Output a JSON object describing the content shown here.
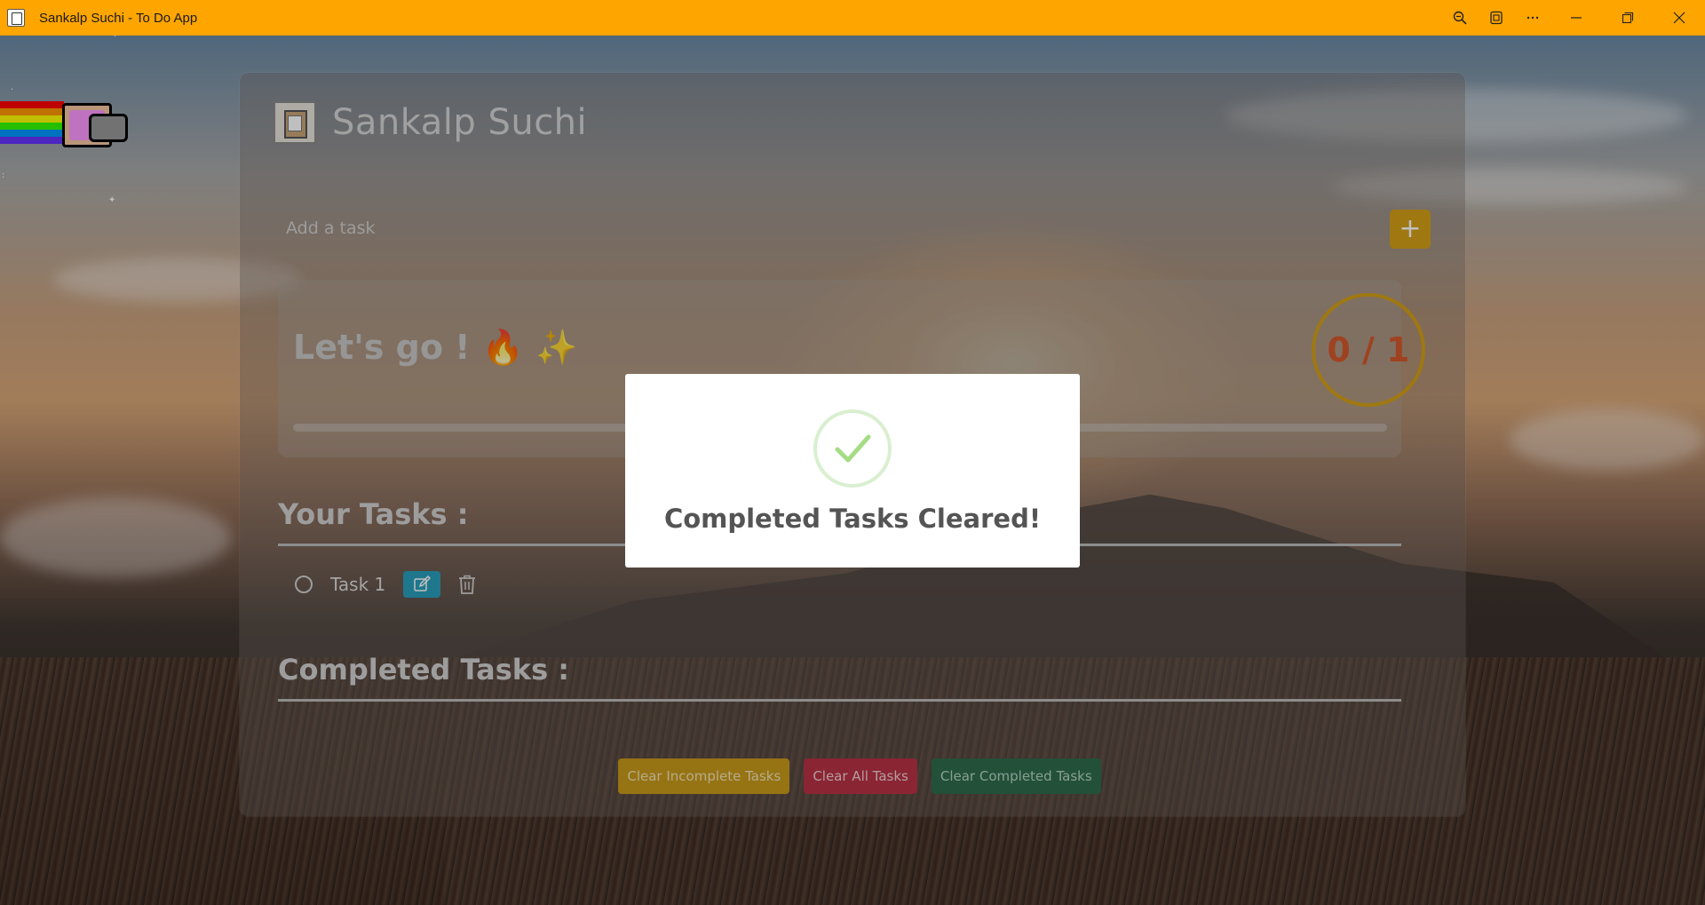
{
  "window": {
    "title": "Sankalp Suchi - To Do App",
    "controls": [
      "zoom-icon",
      "cast-icon",
      "more-icon",
      "minimize-icon",
      "restore-icon",
      "close-icon"
    ]
  },
  "app": {
    "brand": "Sankalp Suchi",
    "add_task_placeholder": "Add a task",
    "add_button": "+"
  },
  "progress": {
    "message": "Let's go ! 🔥 ✨",
    "counter": "0 / 1",
    "completed": 0,
    "total": 1,
    "fraction": 0
  },
  "sections": {
    "your_tasks": "Your Tasks :",
    "completed_tasks": "Completed Tasks :"
  },
  "tasks": [
    {
      "label": "Task 1",
      "done": false
    }
  ],
  "footer": {
    "clear_incomplete": "Clear Incomplete Tasks",
    "clear_all": "Clear All Tasks",
    "clear_completed": "Clear Completed Tasks"
  },
  "modal": {
    "title": "Completed Tasks Cleared!"
  },
  "colors": {
    "titlebar": "#ffa500",
    "accent": "#d4a017",
    "danger": "#b83245",
    "success": "#2f6b4c",
    "edit": "#2a9fbd"
  }
}
